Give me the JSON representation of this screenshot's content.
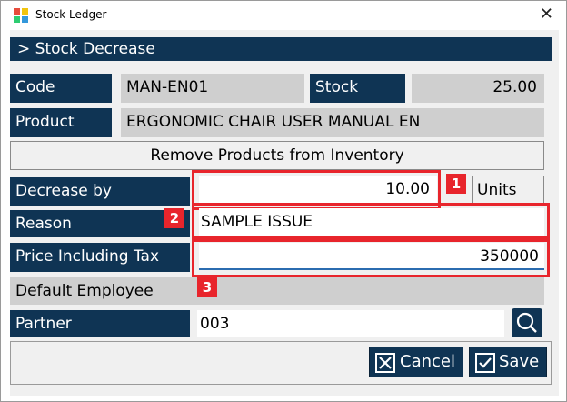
{
  "window": {
    "title": "Stock Ledger"
  },
  "header": {
    "title": "> Stock Decrease"
  },
  "fields": {
    "code_label": "Code",
    "code_value": "MAN-EN01",
    "stock_label": "Stock",
    "stock_value": "25.00",
    "product_label": "Product",
    "product_value": "ERGONOMIC CHAIR USER MANUAL EN",
    "remove_button": "Remove Products from Inventory",
    "decrease_label": "Decrease by",
    "decrease_value": "10.00",
    "units_label": "Units",
    "reason_label": "Reason",
    "reason_value": "SAMPLE ISSUE",
    "price_label": "Price Including Tax",
    "price_value": "350000",
    "employee_label": "Default Employee",
    "partner_label": "Partner",
    "partner_value": "003"
  },
  "annotations": [
    "1",
    "2",
    "3"
  ],
  "buttons": {
    "cancel": "Cancel",
    "save": "Save"
  },
  "colors": {
    "navy": "#0f3454",
    "highlight": "#e8252c"
  }
}
